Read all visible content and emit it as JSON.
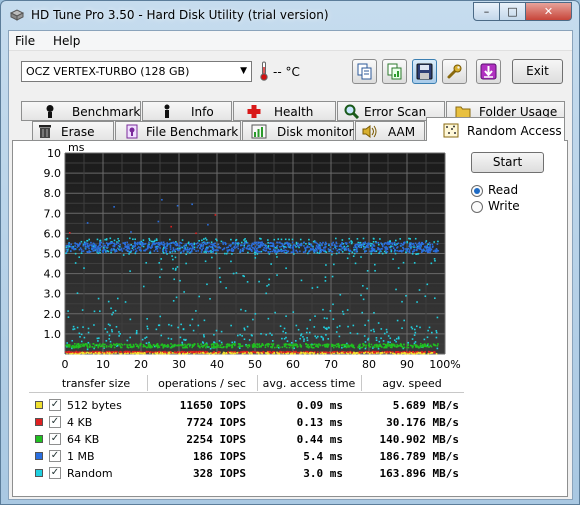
{
  "window": {
    "title": "HD Tune Pro 3.50 - Hard Disk Utility (trial version)",
    "min_glyph": "–",
    "max_glyph": "□",
    "close_glyph": "✕"
  },
  "menu": {
    "file": "File",
    "help": "Help"
  },
  "toolbar": {
    "drive": "OCZ VERTEX-TURBO (128 GB)",
    "temperature": "-- °C",
    "exit_label": "Exit"
  },
  "tabs_top": [
    {
      "label": "Benchmark",
      "icon": "benchmark-icon"
    },
    {
      "label": "Info",
      "icon": "info-icon"
    },
    {
      "label": "Health",
      "icon": "health-icon"
    },
    {
      "label": "Error Scan",
      "icon": "error-scan-icon"
    },
    {
      "label": "Folder Usage",
      "icon": "folder-usage-icon"
    }
  ],
  "tabs_bottom": [
    {
      "label": "Erase",
      "icon": "erase-icon"
    },
    {
      "label": "File Benchmark",
      "icon": "file-benchmark-icon"
    },
    {
      "label": "Disk monitor",
      "icon": "disk-monitor-icon"
    },
    {
      "label": "AAM",
      "icon": "aam-icon"
    },
    {
      "label": "Random Access",
      "icon": "random-access-icon"
    }
  ],
  "controls": {
    "start": "Start",
    "read": "Read",
    "write": "Write",
    "mode": "read"
  },
  "chart_data": {
    "type": "scatter",
    "ylabel": "ms",
    "ylim": [
      0,
      10
    ],
    "xlim": [
      0,
      100
    ],
    "y_ticks": [
      "10",
      "9.0",
      "8.0",
      "7.0",
      "6.0",
      "5.0",
      "4.0",
      "3.0",
      "2.0",
      "1.0"
    ],
    "x_ticks": [
      "0",
      "10",
      "20",
      "30",
      "40",
      "50",
      "60",
      "70",
      "80",
      "90",
      "100%"
    ],
    "grid": true,
    "background": "#000000",
    "series": [
      {
        "name": "512 bytes",
        "color": "#f0e030",
        "band_ms": [
          0.05,
          0.12
        ]
      },
      {
        "name": "4 KB",
        "color": "#e02020",
        "band_ms": [
          0.1,
          0.16
        ]
      },
      {
        "name": "64 KB",
        "color": "#20c020",
        "band_ms": [
          0.35,
          0.55
        ]
      },
      {
        "name": "1 MB",
        "color": "#2a6fe0",
        "band_ms": [
          5.1,
          5.6
        ]
      },
      {
        "name": "Random",
        "color": "#20d0e0",
        "band_ms": [
          0.2,
          5.8
        ]
      }
    ]
  },
  "table": {
    "headers": [
      "transfer size",
      "operations / sec",
      "avg. access time",
      "agv. speed"
    ],
    "rows": [
      {
        "size": "512 bytes",
        "ops": "11650 IOPS",
        "time": "0.09 ms",
        "speed": "5.689 MB/s",
        "color": "#f0e030",
        "checked": "✓"
      },
      {
        "size": "4 KB",
        "ops": "7724 IOPS",
        "time": "0.13 ms",
        "speed": "30.176 MB/s",
        "color": "#e02020",
        "checked": "✓"
      },
      {
        "size": "64 KB",
        "ops": "2254 IOPS",
        "time": "0.44 ms",
        "speed": "140.902 MB/s",
        "color": "#20c020",
        "checked": "✓"
      },
      {
        "size": "1 MB",
        "ops": "186 IOPS",
        "time": "5.4 ms",
        "speed": "186.789 MB/s",
        "color": "#2a6fe0",
        "checked": "✓"
      },
      {
        "size": "Random",
        "ops": "328 IOPS",
        "time": "3.0 ms",
        "speed": "163.896 MB/s",
        "color": "#20d0e0",
        "checked": "✓"
      }
    ]
  }
}
